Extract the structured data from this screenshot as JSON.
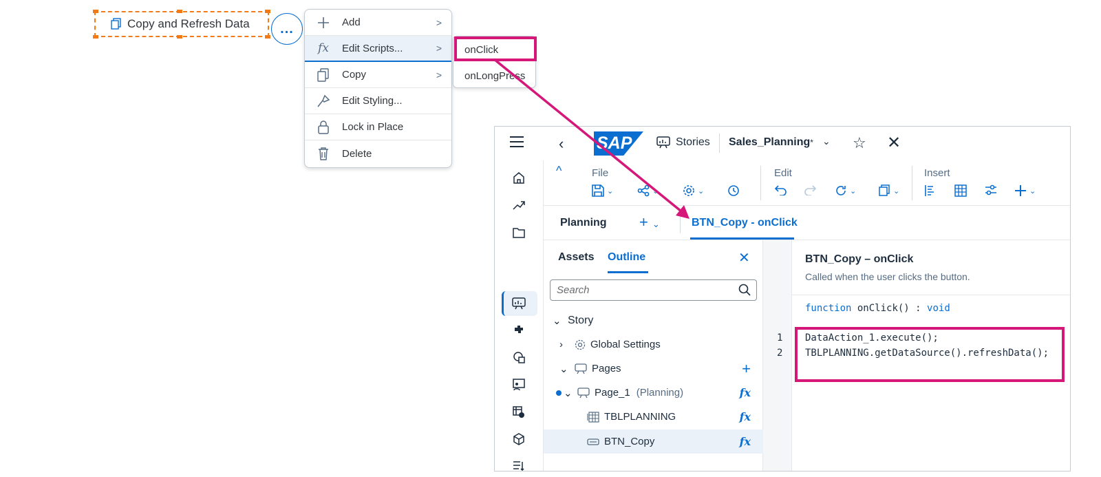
{
  "copy_button": {
    "label": "Copy and Refresh Data"
  },
  "more_button": {
    "label": "..."
  },
  "context_menu": {
    "items": [
      {
        "label": "Add",
        "icon": "plus-icon",
        "has_submenu": true
      },
      {
        "label": "Edit Scripts...",
        "icon": "fx-icon",
        "has_submenu": true
      },
      {
        "label": "Copy",
        "icon": "copy-icon",
        "has_submenu": true
      },
      {
        "label": "Edit Styling...",
        "icon": "brush-icon",
        "has_submenu": false
      },
      {
        "label": "Lock in Place",
        "icon": "lock-icon",
        "has_submenu": false
      },
      {
        "label": "Delete",
        "icon": "trash-icon",
        "has_submenu": false
      }
    ],
    "fx_glyph": "fx",
    "chevron": ">"
  },
  "submenu": {
    "items": [
      "onClick",
      "onLongPress"
    ]
  },
  "shell": {
    "logo_text": "SAP",
    "stories_label": "Stories",
    "story_name": "Sales_Planning",
    "modified_marker": "*",
    "back": "‹",
    "chevron_down": "⌄",
    "star": "☆",
    "close": "✕"
  },
  "toolbar": {
    "sections": [
      "File",
      "Edit",
      "Insert"
    ],
    "caret_up": "^",
    "icons": [
      "save-icon",
      "share-icon",
      "settings-icon",
      "history-icon",
      "undo-icon",
      "redo-icon",
      "refresh-icon",
      "copy-icon",
      "outline-icon",
      "table-icon",
      "adjust-icon",
      "plus-icon"
    ]
  },
  "tabs": {
    "planning": "Planning",
    "plus": "+",
    "script_tab": "BTN_Copy - onClick"
  },
  "outline_panel": {
    "tabs": [
      "Assets",
      "Outline"
    ],
    "close": "✕",
    "search_placeholder": "Search",
    "tree": [
      {
        "label": "Story",
        "suffix": "",
        "toggle": "⌄",
        "fx": ""
      },
      {
        "label": "Global Settings",
        "suffix": "",
        "toggle": "›",
        "fx": ""
      },
      {
        "label": "Pages",
        "suffix": "",
        "toggle": "⌄",
        "fx": "+"
      },
      {
        "label": "Page_1",
        "suffix": "(Planning)",
        "toggle": "⌄",
        "fx": "fx"
      },
      {
        "label": "TBLPLANNING",
        "suffix": "",
        "toggle": "",
        "fx": "fx"
      },
      {
        "label": "BTN_Copy",
        "suffix": "",
        "toggle": "",
        "fx": "fx"
      }
    ]
  },
  "editor": {
    "title": "BTN_Copy – onClick",
    "description": "Called when the user clicks the button.",
    "sig_keyword": "function",
    "sig_name": "onClick() :",
    "sig_type": "void",
    "lines": [
      {
        "num": "1",
        "text": "DataAction_1.execute();"
      },
      {
        "num": "2",
        "text": "TBLPLANNING.getDataSource().refreshData();"
      }
    ]
  },
  "colors": {
    "accent": "#0a6ed1",
    "highlight": "#d6177a",
    "selection_outline": "#f07b18"
  }
}
